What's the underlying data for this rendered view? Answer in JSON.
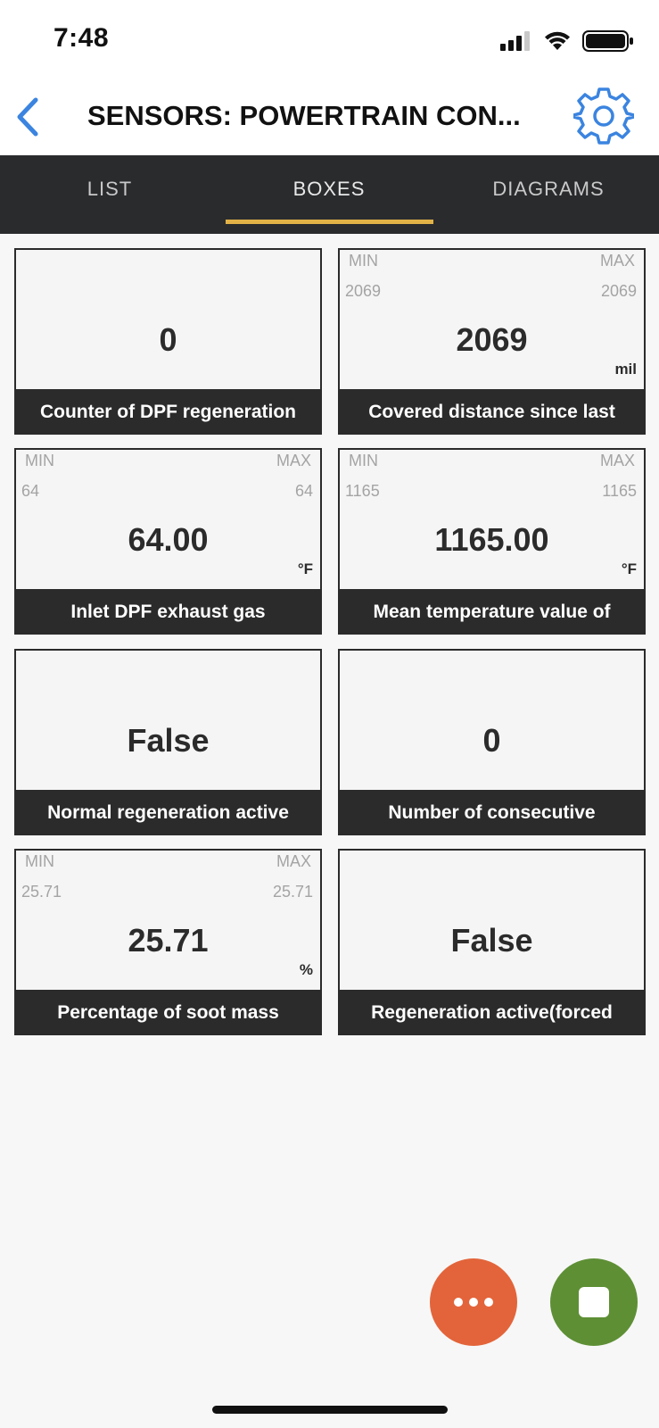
{
  "status_bar": {
    "time": "7:48"
  },
  "nav": {
    "title": "SENSORS: POWERTRAIN CON..."
  },
  "tabs": [
    {
      "label": "LIST",
      "selected": false
    },
    {
      "label": "BOXES",
      "selected": true
    },
    {
      "label": "DIAGRAMS",
      "selected": false
    }
  ],
  "colors": {
    "tab_bar_bg": "#2a2b2d",
    "tab_active_underline": "#e2b246",
    "accent_blue": "#3b84e0",
    "more_button": "#e3643a",
    "stop_button": "#5e8f35"
  },
  "boxes": [
    {
      "value": "0",
      "caption": "Counter of DPF regeneration"
    },
    {
      "min_label": "MIN",
      "max_label": "MAX",
      "min": "2069",
      "max": "2069",
      "value": "2069",
      "unit": "mil",
      "caption": "Covered distance since last"
    },
    {
      "min_label": "MIN",
      "max_label": "MAX",
      "min": "64",
      "max": "64",
      "value": "64.00",
      "unit": "°F",
      "caption": "Inlet DPF exhaust gas"
    },
    {
      "min_label": "MIN",
      "max_label": "MAX",
      "min": "1165",
      "max": "1165",
      "value": "1165.00",
      "unit": "°F",
      "caption": "Mean temperature value of"
    },
    {
      "value": "False",
      "caption": "Normal regeneration active"
    },
    {
      "value": "0",
      "caption": "Number of consecutive"
    },
    {
      "min_label": "MIN",
      "max_label": "MAX",
      "min": "25.71",
      "max": "25.71",
      "value": "25.71",
      "unit": "%",
      "caption": "Percentage of soot mass"
    },
    {
      "value": "False",
      "caption": "Regeneration active(forced"
    }
  ],
  "actions": {
    "more_icon": "more-horizontal-icon",
    "stop_icon": "stop-icon"
  }
}
